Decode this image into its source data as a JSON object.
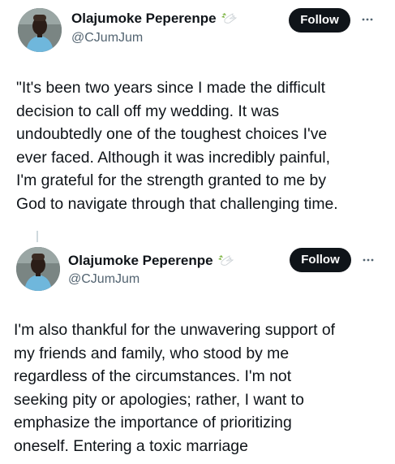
{
  "tweets": [
    {
      "display_name": "Olajumoke Peperenpe",
      "handle": "@CJumJum",
      "follow_label": "Follow",
      "avatar_icon": "profile-photo",
      "badge_icon": "dove-icon",
      "more_icon": "more-options-icon",
      "text": "\"It's been two years since I made the difficult\ndecision to call off my wedding. It was\nundoubtedly one of the toughest choices I've\never faced. Although it was incredibly painful,\nI'm grateful for the strength granted to me by\nGod to navigate through that challenging time."
    },
    {
      "display_name": "Olajumoke Peperenpe",
      "handle": "@CJumJum",
      "follow_label": "Follow",
      "avatar_icon": "profile-photo",
      "badge_icon": "dove-icon",
      "more_icon": "more-options-icon",
      "text": "I'm also thankful for the unwavering support of\nmy friends and family, who stood by me\nregardless of the circumstances. I'm not\nseeking pity or apologies; rather, I want to\nemphasize the importance of prioritizing\noneself. Entering a toxic marriage"
    }
  ],
  "colors": {
    "text_primary": "#0f1419",
    "text_secondary": "#536471",
    "follow_bg": "#0f1419",
    "follow_text": "#ffffff",
    "thread_line": "#cfd9de"
  }
}
